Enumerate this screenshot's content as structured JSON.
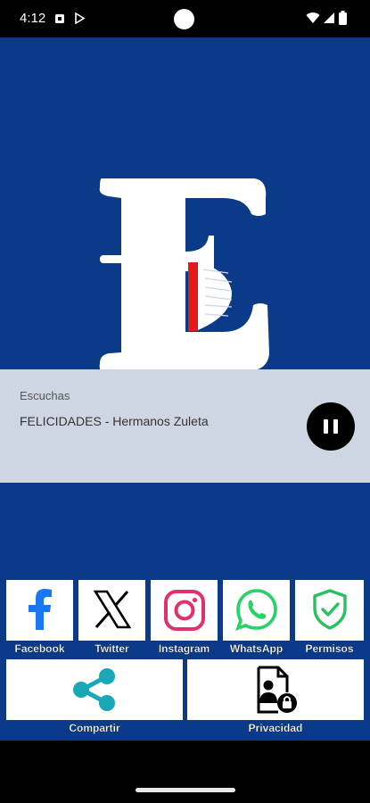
{
  "status_bar": {
    "time": "4:12",
    "left_icons": [
      "square-notification-icon",
      "play-store-icon"
    ],
    "right_icons": [
      "wifi-icon",
      "signal-icon",
      "battery-icon"
    ]
  },
  "colors": {
    "background": "#0a3a88",
    "player_panel": "#cfd6e3",
    "facebook": "#1877f2",
    "instagram": "#e1306c",
    "whatsapp": "#25d366",
    "shield": "#25c25e",
    "share": "#1aa8b8"
  },
  "player": {
    "label": "Escuchas",
    "track": "FELICIDADES - Hermanos Zuleta"
  },
  "buttons": {
    "facebook": "Facebook",
    "twitter": "Twitter",
    "instagram": "Instagram",
    "whatsapp": "WhatsApp",
    "permisos": "Permisos",
    "compartir": "Compartir",
    "privacidad": "Privacidad"
  }
}
